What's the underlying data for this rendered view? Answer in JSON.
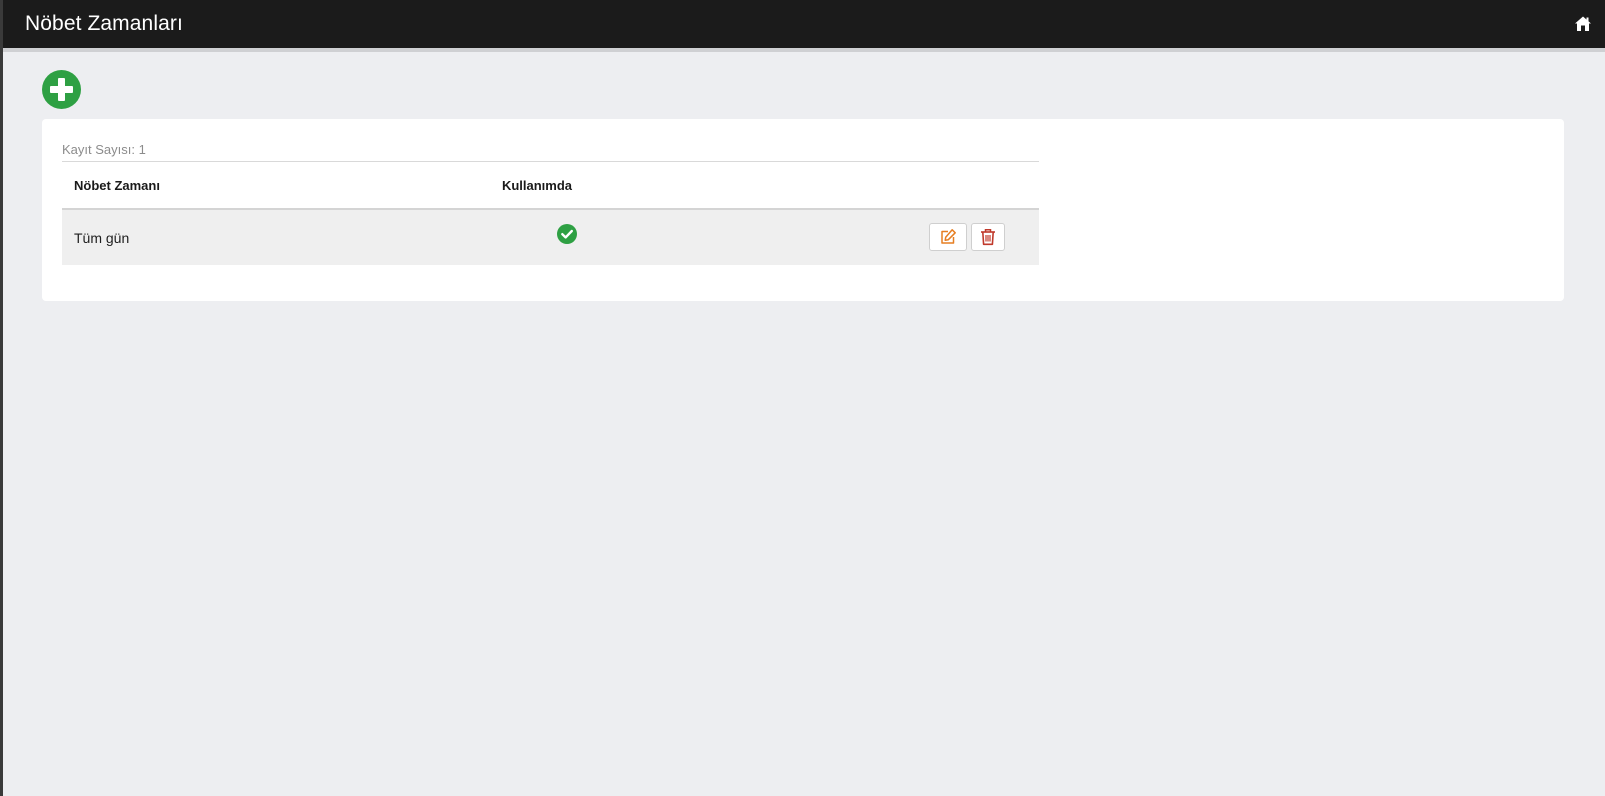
{
  "header": {
    "title": "Nöbet Zamanları",
    "home_icon": "home-icon"
  },
  "toolbar": {
    "add_icon": "plus-circle-icon",
    "add_color": "#2ea043"
  },
  "list": {
    "record_count_label": "Kayıt Sayısı: 1",
    "columns": [
      "Nöbet Zamanı",
      "Kullanımda"
    ],
    "rows": [
      {
        "name": "Tüm gün",
        "in_use": true,
        "in_use_icon": "check-circle-icon",
        "actions": [
          "edit-icon",
          "trash-icon"
        ]
      }
    ]
  },
  "colors": {
    "header_bg": "#1b1b1b",
    "page_bg": "#edeef1",
    "success": "#2ea043",
    "edit": "#e67e22",
    "delete": "#c0392b"
  }
}
